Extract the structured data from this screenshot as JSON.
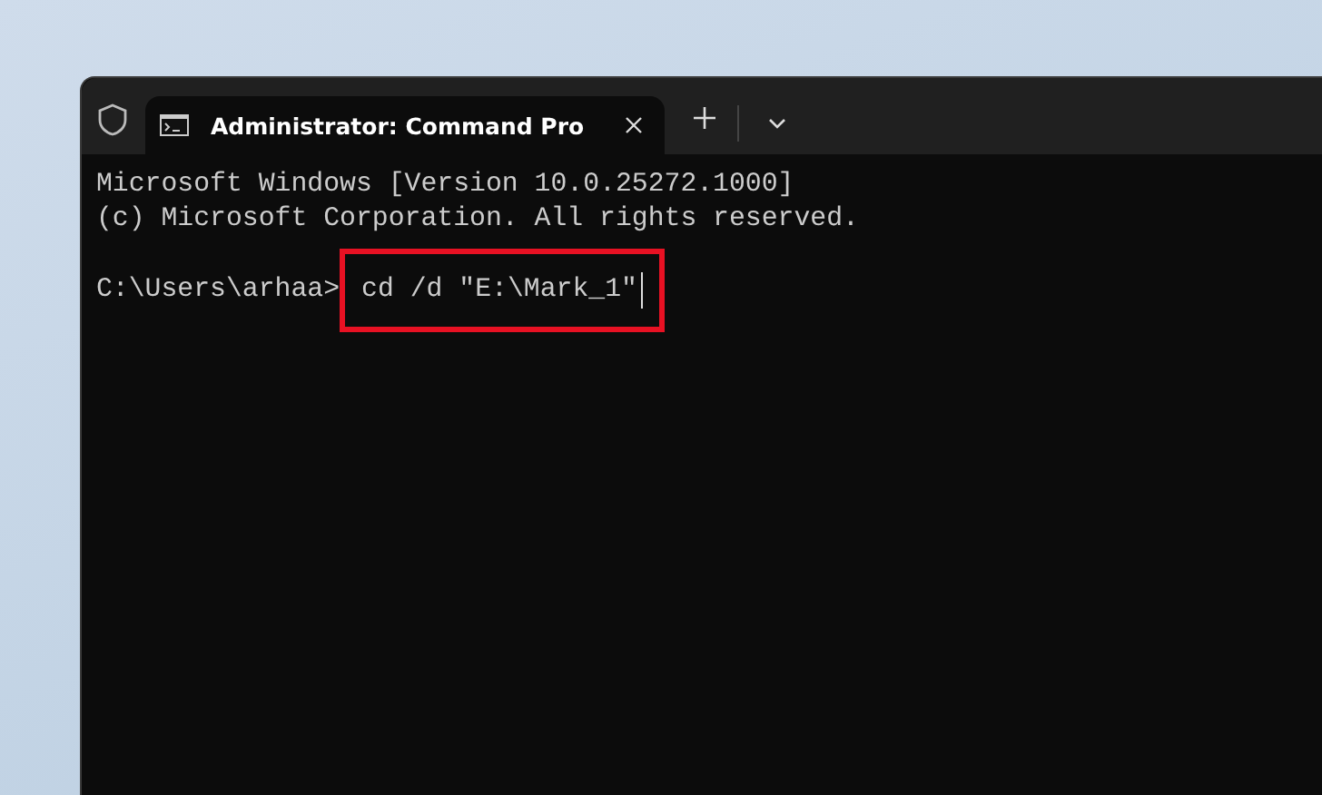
{
  "tabs": [
    {
      "title": "Administrator: Command Pro",
      "selected": true
    }
  ],
  "terminal": {
    "lines": [
      "Microsoft Windows [Version 10.0.25272.1000]",
      "(c) Microsoft Corporation. All rights reserved."
    ],
    "prompt": "C:\\Users\\arhaa>",
    "command": "cd /d \"E:\\Mark_1\"",
    "highlighted": true,
    "cursor": true
  }
}
